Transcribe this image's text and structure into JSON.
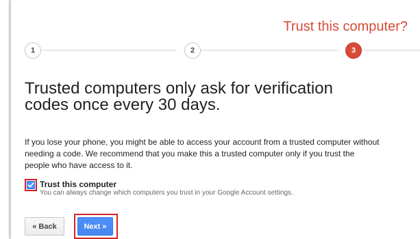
{
  "header": {
    "step_title": "Trust this computer?"
  },
  "stepper": {
    "steps": [
      {
        "label": "1",
        "active": false
      },
      {
        "label": "2",
        "active": false
      },
      {
        "label": "3",
        "active": true
      }
    ]
  },
  "main": {
    "heading": "Trusted computers only ask for verification codes once every 30 days.",
    "body": "If you lose your phone, you might be able to access your account from a trusted computer without needing a code. We recommend that you make this a trusted computer only if you trust the people who have access to it."
  },
  "trust": {
    "checked": true,
    "label": "Trust this computer",
    "sublabel": "You can always change which computers you trust in your Google Account settings."
  },
  "buttons": {
    "back_label": "« Back",
    "next_label": "Next »"
  },
  "colors": {
    "accent_red": "#d84a38",
    "primary_blue": "#4d90fe",
    "highlight_red": "#d92020"
  }
}
